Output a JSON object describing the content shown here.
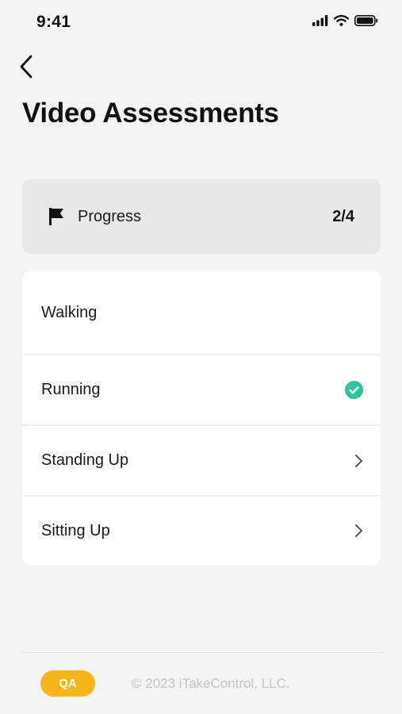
{
  "status_bar": {
    "time": "9:41",
    "icons": [
      "cellular-signal-icon",
      "wifi-icon",
      "battery-icon"
    ]
  },
  "header": {
    "back_icon": "chevron-left-icon",
    "title": "Video Assessments"
  },
  "progress": {
    "icon": "flag-icon",
    "label": "Progress",
    "count": "2/4"
  },
  "assessments": [
    {
      "label": "Walking",
      "accessory": "none"
    },
    {
      "label": "Running",
      "accessory": "check-circle-icon"
    },
    {
      "label": "Standing Up",
      "accessory": "chevron-right-icon"
    },
    {
      "label": "Sitting Up",
      "accessory": "chevron-right-icon"
    }
  ],
  "footer": {
    "badge": "QA",
    "copyright": "© 2023 iTakeControl, LLC."
  },
  "colors": {
    "background": "#f4f4f4",
    "card": "#ffffff",
    "progress_card": "#e9e9e9",
    "check": "#2ec4a0",
    "badge": "#f7b51c",
    "muted_text": "#c4c4c4"
  }
}
